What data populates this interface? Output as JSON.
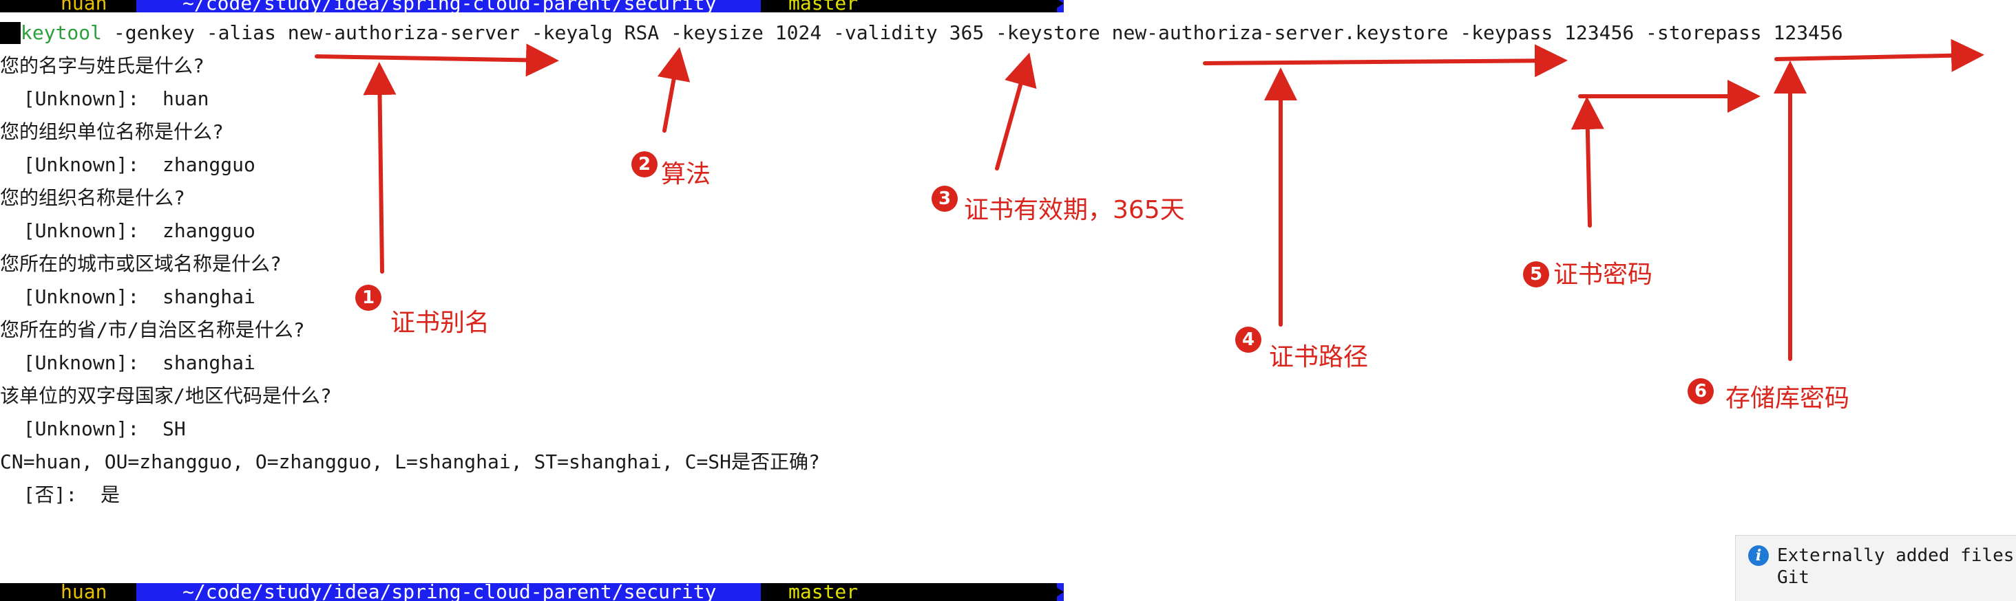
{
  "prompt": {
    "user": "huan",
    "path": "~/code/study/idea/spring-cloud-parent/security",
    "branch": "master"
  },
  "command": {
    "keyword": "keytool",
    "args": " -genkey -alias new-authoriza-server -keyalg RSA -keysize 1024 -validity 365 -keystore new-authoriza-server.keystore -keypass 123456 -storepass 123456"
  },
  "output_lines": [
    "您的名字与姓氏是什么?",
    "  [Unknown]:  huan",
    "您的组织单位名称是什么?",
    "  [Unknown]:  zhangguo",
    "您的组织名称是什么?",
    "  [Unknown]:  zhangguo",
    "您所在的城市或区域名称是什么?",
    "  [Unknown]:  shanghai",
    "您所在的省/市/自治区名称是什么?",
    "  [Unknown]:  shanghai",
    "该单位的双字母国家/地区代码是什么?",
    "  [Unknown]:  SH",
    "CN=huan, OU=zhangguo, O=zhangguo, L=shanghai, ST=shanghai, C=SH是否正确?",
    "  [否]:  是"
  ],
  "annotations": [
    {
      "number": "1",
      "label": "证书别名"
    },
    {
      "number": "2",
      "label": "算法"
    },
    {
      "number": "3",
      "label": "证书有效期，365天"
    },
    {
      "number": "4",
      "label": "证书路径"
    },
    {
      "number": "5",
      "label": "证书密码"
    },
    {
      "number": "6",
      "label": "存储库密码"
    }
  ],
  "notification": {
    "message": "Externally added files",
    "source": "Git"
  },
  "colors": {
    "annotation": "#d9251c",
    "prompt_bar": "#1c20f0",
    "command_keyword": "#2b9f3a"
  }
}
